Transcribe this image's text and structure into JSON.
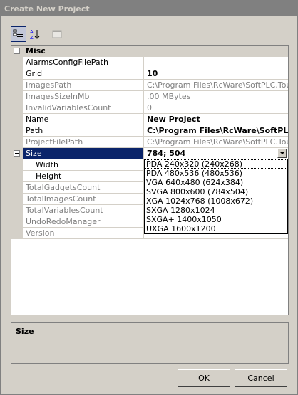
{
  "window": {
    "title": "Create New Project"
  },
  "toolbar": {
    "icons": [
      "categorized-icon",
      "alphabetical-sort-icon",
      "property-pages-icon"
    ]
  },
  "grid": {
    "category": "Misc",
    "rows": [
      {
        "name": "AlarmsConfigFilePath",
        "value": ""
      },
      {
        "name": "Grid",
        "value": "10"
      },
      {
        "name": "ImagesPath",
        "value": "C:\\Program Files\\RcWare\\SoftPLC.Touch"
      },
      {
        "name": "ImagesSizeInMb",
        "value": ".00 MBytes"
      },
      {
        "name": "InvalidVariablesCount",
        "value": "0"
      },
      {
        "name": "Name",
        "value": "New Project"
      },
      {
        "name": "Path",
        "value": "C:\\Program Files\\RcWare\\SoftPLC"
      },
      {
        "name": "ProjectFilePath",
        "value": "C:\\Program Files\\RcWare\\SoftPLC.Touch"
      },
      {
        "name": "Size",
        "value": "784; 504"
      },
      {
        "name": "Width",
        "value": ""
      },
      {
        "name": "Height",
        "value": ""
      },
      {
        "name": "TotalGadgetsCount",
        "value": ""
      },
      {
        "name": "TotalImagesCount",
        "value": ""
      },
      {
        "name": "TotalVariablesCount",
        "value": ""
      },
      {
        "name": "UndoRedoManager",
        "value": ""
      },
      {
        "name": "Version",
        "value": ""
      }
    ]
  },
  "size_dropdown": {
    "options": [
      "PDA  240x320  (240x268)",
      "PDA  480x536  (480x536)",
      "VGA  640x480  (624x384)",
      "SVGA 800x600  (784x504)",
      "XGA 1024x768 (1008x672)",
      "SXGA 1280x1024",
      "SXGA+ 1400x1050",
      "UXGA 1600x1200"
    ]
  },
  "description": {
    "title": "Size"
  },
  "buttons": {
    "ok": "OK",
    "cancel": "Cancel"
  }
}
